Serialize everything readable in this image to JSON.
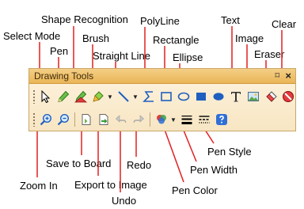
{
  "toolbar": {
    "title": "Drawing Tools",
    "pin_glyph": "⌑",
    "close_glyph": "×"
  },
  "callouts": {
    "select_mode": "Select Mode",
    "pen": "Pen",
    "shape_recognition": "Shape Recognition",
    "brush": "Brush",
    "straight_line": "Straight Line",
    "polyline": "PolyLine",
    "rectangle": "Rectangle",
    "ellipse": "Ellipse",
    "text": "Text",
    "image": "Image",
    "eraser": "Eraser",
    "clear": "Clear",
    "zoom_in": "Zoom In",
    "save_to_board": "Save to Board",
    "export_to_image": "Export to Image",
    "undo": "Undo",
    "redo": "Redo",
    "pen_color": "Pen Color",
    "pen_width": "Pen Width",
    "pen_style": "Pen Style"
  },
  "icons": {
    "row1": [
      "select-mode-icon",
      "pen-icon",
      "shape-recognition-icon",
      "brush-icon",
      "straight-line-icon",
      "polyline-icon",
      "rectangle-icon",
      "ellipse-icon",
      "filled-rectangle-icon",
      "filled-ellipse-icon",
      "text-icon",
      "image-icon",
      "eraser-icon",
      "clear-icon"
    ],
    "row2": [
      "zoom-in-icon",
      "zoom-out-icon",
      "save-to-board-icon",
      "export-to-image-icon",
      "undo-icon",
      "redo-icon",
      "pen-color-icon",
      "pen-width-icon",
      "pen-style-icon",
      "help-icon"
    ]
  },
  "colors": {
    "arrow": "#e02020",
    "title_bar": "#eab557",
    "accent_blue": "#1f5fbf"
  }
}
